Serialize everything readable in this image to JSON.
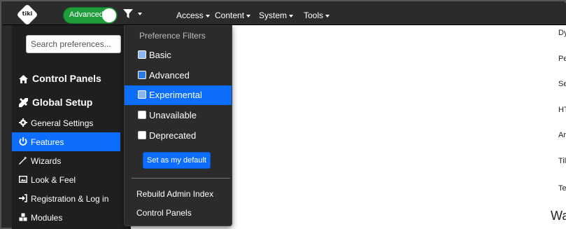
{
  "navbar": {
    "logo_text": "tiki",
    "mode_toggle": {
      "label": "Advanced",
      "on": true,
      "color": "#1f9d3b"
    },
    "filter_icon": "filter-icon",
    "menus": [
      {
        "label": "Access"
      },
      {
        "label": "Content"
      },
      {
        "label": "System"
      },
      {
        "label": "Tools"
      }
    ]
  },
  "sidebar": {
    "search": {
      "placeholder": "Search preferences...",
      "value": ""
    },
    "headings": [
      {
        "label": "Control Panels",
        "icon": "home-icon"
      },
      {
        "label": "Global Setup",
        "icon": "tools-icon"
      }
    ],
    "items": [
      {
        "label": "General Settings",
        "icon": "gear-icon",
        "active": false
      },
      {
        "label": "Features",
        "icon": "power-icon",
        "active": true
      },
      {
        "label": "Wizards",
        "icon": "magic-wand-icon",
        "active": false
      },
      {
        "label": "Look & Feel",
        "icon": "image-icon",
        "active": false
      },
      {
        "label": "Registration & Log in",
        "icon": "sign-in-icon",
        "active": false
      },
      {
        "label": "Modules",
        "icon": "cubes-icon",
        "active": false
      }
    ]
  },
  "filter_dropdown": {
    "title": "Preference Filters",
    "options": [
      {
        "label": "Basic",
        "checked": true,
        "active": false
      },
      {
        "label": "Advanced",
        "checked": true,
        "active": false
      },
      {
        "label": "Experimental",
        "checked": true,
        "active": true
      },
      {
        "label": "Unavailable",
        "checked": false,
        "active": false
      },
      {
        "label": "Deprecated",
        "checked": false,
        "active": false
      }
    ],
    "default_button": "Set as my default",
    "links": [
      "Rebuild Admin Index",
      "Control Panels"
    ]
  },
  "main": {
    "truncated_labels": [
      "Dy",
      "Pe",
      "Se",
      "HT",
      "Ar",
      "Til",
      "Te"
    ],
    "heading_fragment": "Wa"
  },
  "colors": {
    "accent": "#0d6efd",
    "toggle_on": "#1f9d3b",
    "navbar_bg": "#2b2b2b",
    "sidebar_bg": "#1f1f1f"
  }
}
